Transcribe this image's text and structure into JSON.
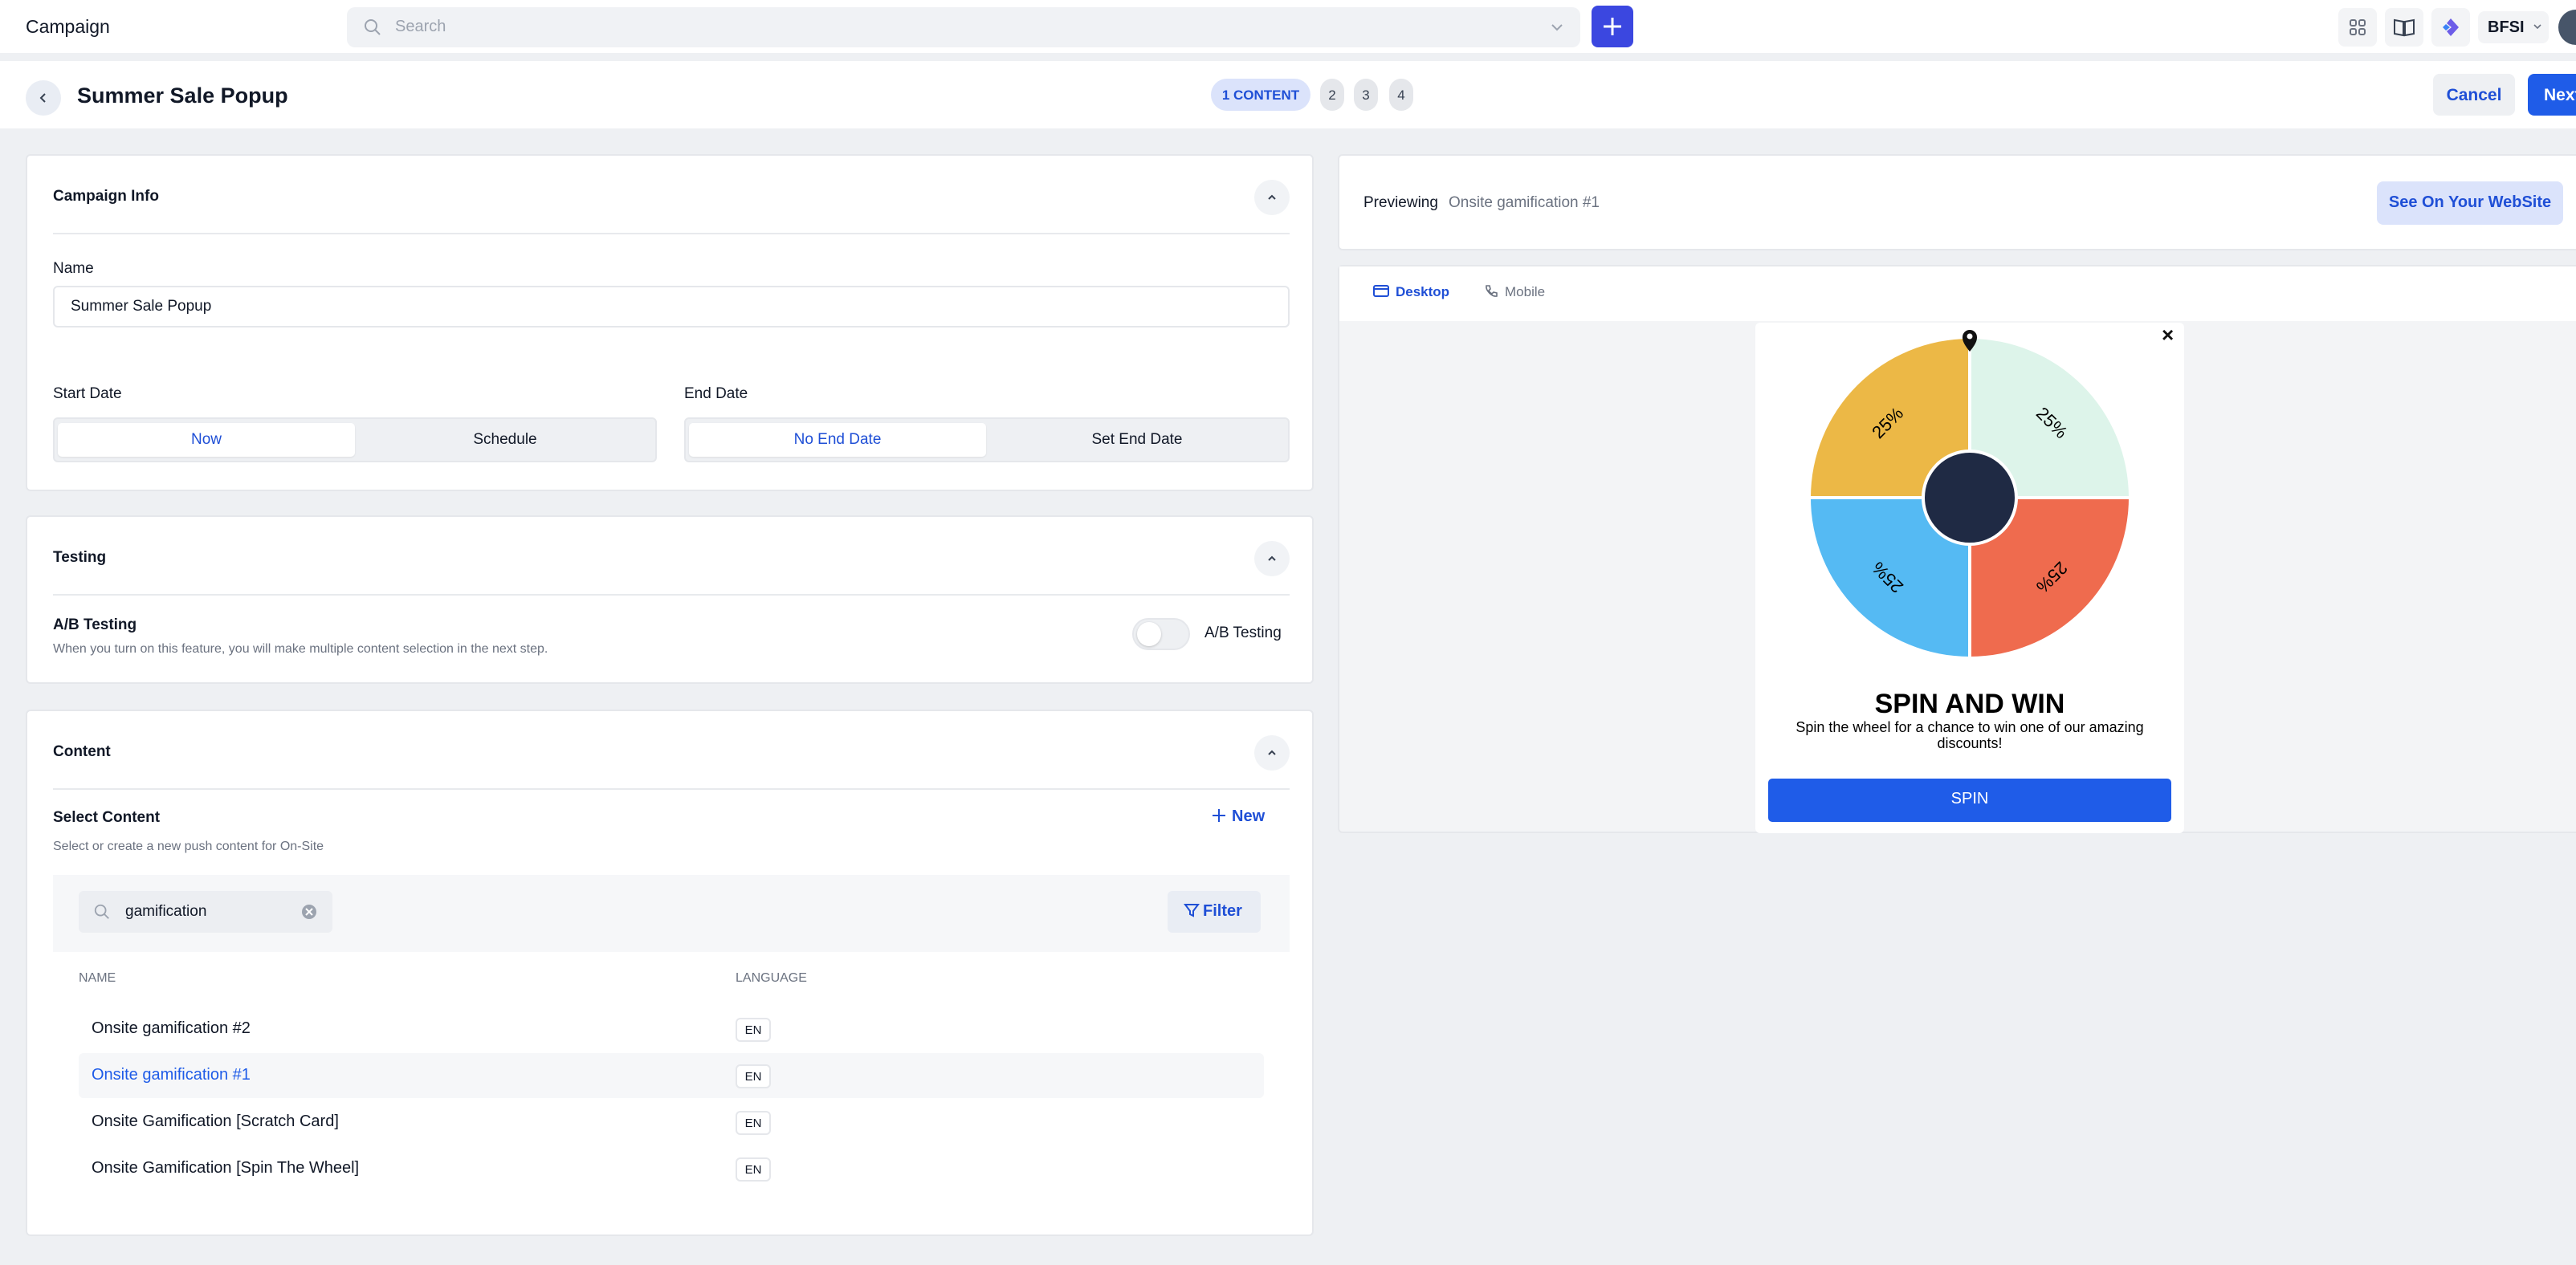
{
  "app": {
    "title": "Campaign"
  },
  "search": {
    "placeholder": "Search"
  },
  "workspace": {
    "label": "BFSI"
  },
  "header": {
    "title": "Summer Sale Popup",
    "steps": [
      "1 CONTENT",
      "2",
      "3",
      "4"
    ],
    "cancel_label": "Cancel",
    "next_label": "Next"
  },
  "campaign_info": {
    "title": "Campaign Info",
    "name_label": "Name",
    "name_value": "Summer Sale Popup",
    "start_label": "Start Date",
    "start_options": [
      "Now",
      "Schedule"
    ],
    "end_label": "End Date",
    "end_options": [
      "No End Date",
      "Set End Date"
    ]
  },
  "testing": {
    "title": "Testing",
    "ab_title": "A/B Testing",
    "ab_desc": "When you turn on this feature, you will make multiple content selection in the next step.",
    "toggle_label": "A/B Testing",
    "toggle_on": false
  },
  "content": {
    "title": "Content",
    "select_title": "Select Content",
    "select_desc": "Select or create a new push content for On-Site",
    "new_label": "New",
    "search_value": "gamification",
    "filter_label": "Filter",
    "columns": [
      "NAME",
      "LANGUAGE"
    ],
    "rows": [
      {
        "name": "Onsite gamification #2",
        "lang": "EN"
      },
      {
        "name": "Onsite gamification #1",
        "lang": "EN"
      },
      {
        "name": "Onsite Gamification [Scratch Card]",
        "lang": "EN"
      },
      {
        "name": "Onsite Gamification [Spin The Wheel]",
        "lang": "EN"
      }
    ],
    "selected_index": 1
  },
  "preview": {
    "label": "Previewing",
    "item": "Onsite gamification #1",
    "see_button": "See On Your WebSite",
    "tabs": [
      "Desktop",
      "Mobile"
    ],
    "active_tab": "Desktop"
  },
  "popup": {
    "title": "SPIN AND WIN",
    "subtitle": "Spin the wheel for a chance to win one of our amazing discounts!",
    "button": "SPIN",
    "close_glyph": "×",
    "segments": [
      {
        "label": "25%",
        "color": "#ddf4ea"
      },
      {
        "label": "25%",
        "color": "#ef6b4e"
      },
      {
        "label": "25%",
        "color": "#55baf3"
      },
      {
        "label": "25%",
        "color": "#ecb846"
      }
    ],
    "hub_color": "#1f2a44"
  },
  "colors": {
    "accent": "#1f5ce8",
    "brand": "#3b47e0"
  }
}
